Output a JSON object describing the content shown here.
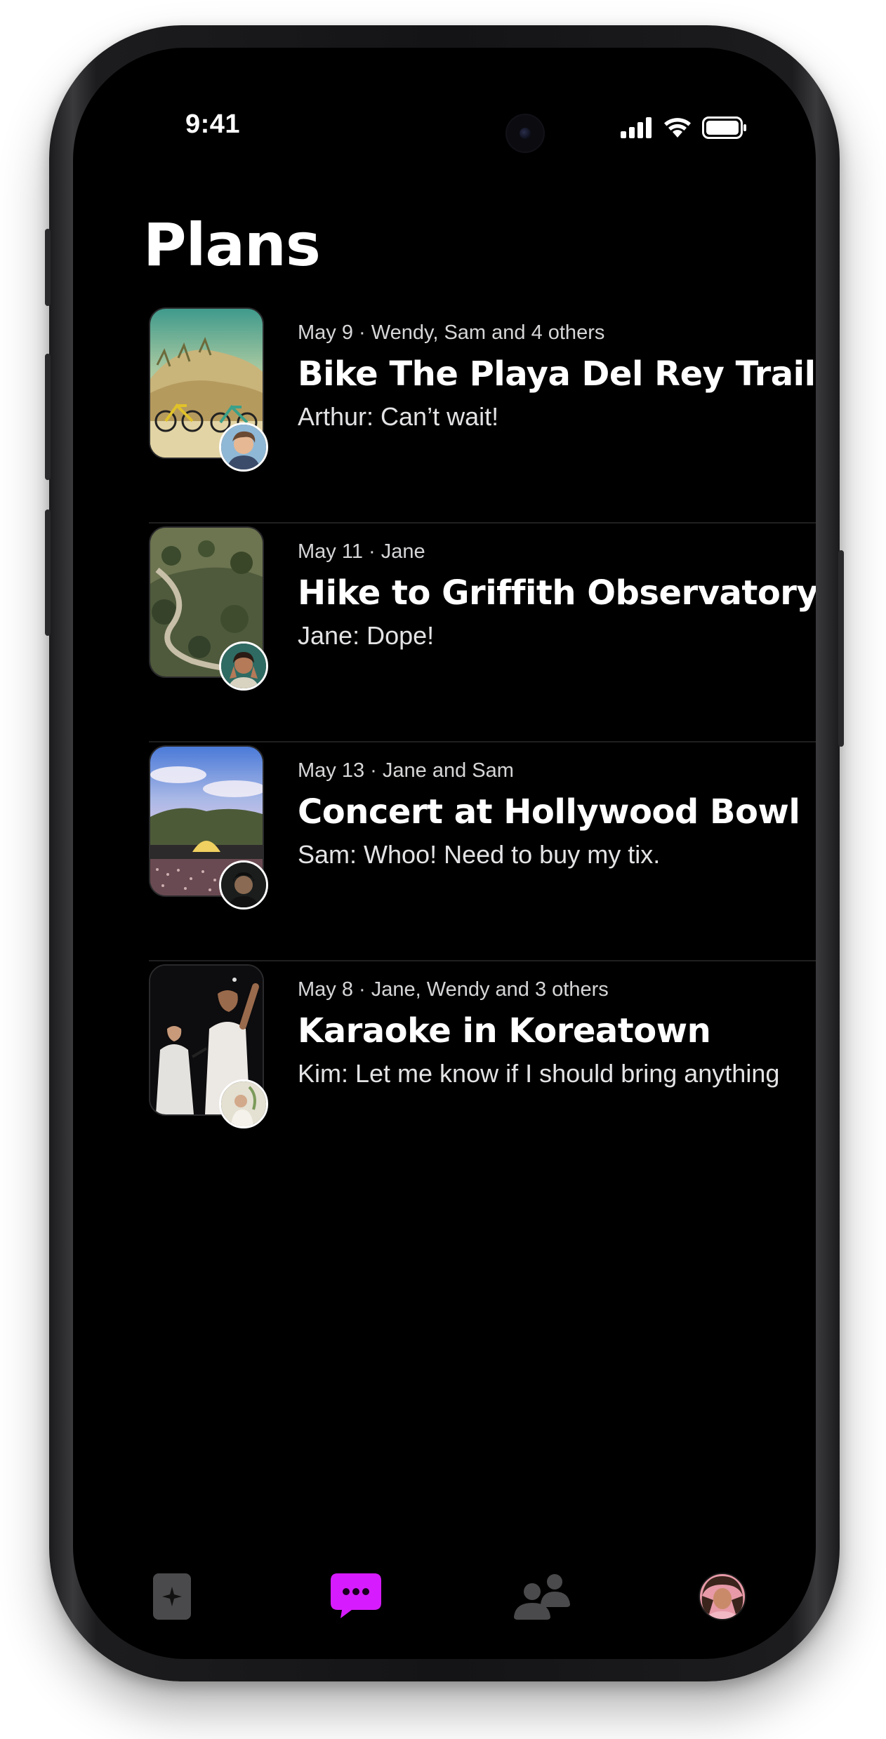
{
  "status_bar": {
    "time": "9:41",
    "icons": [
      "cellular-signal-icon",
      "wifi-icon",
      "battery-icon"
    ]
  },
  "page": {
    "title": "Plans"
  },
  "plans": [
    {
      "meta": "May 9 · Wendy, Sam and 4 others",
      "title": "Bike The Playa Del Rey Trail",
      "preview": "Arthur: Can’t wait!",
      "thumbnail": "beach-bikes-photo",
      "avatar": "arthur-avatar"
    },
    {
      "meta": "May 11 · Jane",
      "title": "Hike to Griffith Observatory",
      "preview": "Jane: Dope!",
      "thumbnail": "canyon-trail-photo",
      "avatar": "jane-avatar"
    },
    {
      "meta": "May 13 · Jane and Sam",
      "title": "Concert at Hollywood Bowl",
      "preview": "Sam: Whoo! Need to buy my tix.",
      "thumbnail": "hollywood-bowl-photo",
      "avatar": "sam-avatar"
    },
    {
      "meta": "May 8 · Jane, Wendy and 3 others",
      "title": "Karaoke in Koreatown",
      "preview": "Kim: Let me know if I should bring anything",
      "thumbnail": "karaoke-singers-photo",
      "avatar": "kim-avatar"
    }
  ],
  "tab_bar": {
    "tabs": [
      {
        "icon": "sparkle-icon",
        "active": false
      },
      {
        "icon": "chat-bubble-icon",
        "active": true
      },
      {
        "icon": "people-icon",
        "active": false
      },
      {
        "icon": "profile-avatar",
        "active": false
      }
    ],
    "active_color": "#d61cff",
    "inactive_color": "#4a4a4c"
  },
  "colors": {
    "background": "#000000",
    "text_primary": "#ffffff",
    "divider": "#1f1f21"
  }
}
